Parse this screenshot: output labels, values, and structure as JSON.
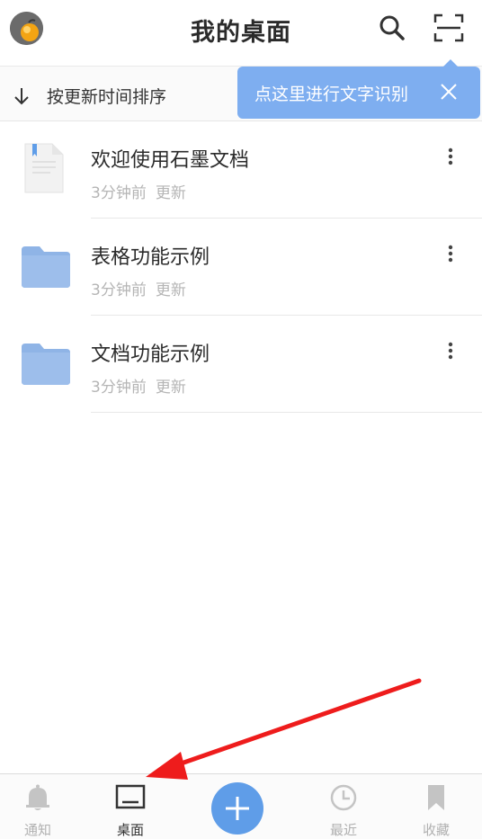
{
  "header": {
    "title": "我的桌面"
  },
  "sortbar": {
    "label": "按更新时间排序"
  },
  "tooltip": {
    "text": "点这里进行文字识别"
  },
  "files": [
    {
      "name": "欢迎使用石墨文档",
      "time": "3分钟前",
      "action": "更新",
      "type": "document"
    },
    {
      "name": "表格功能示例",
      "time": "3分钟前",
      "action": "更新",
      "type": "folder"
    },
    {
      "name": "文档功能示例",
      "time": "3分钟前",
      "action": "更新",
      "type": "folder"
    }
  ],
  "tabs": [
    {
      "label": "通知",
      "icon": "bell-icon",
      "active": false
    },
    {
      "label": "桌面",
      "icon": "desktop-icon",
      "active": true
    },
    {
      "label": "最近",
      "icon": "clock-icon",
      "active": false
    },
    {
      "label": "收藏",
      "icon": "bookmark-icon",
      "active": false
    }
  ],
  "colors": {
    "accent": "#5f9de8",
    "tooltip": "#7eaef0",
    "folder": "#8fb4e6",
    "annotation_arrow": "#ee1c1c"
  }
}
